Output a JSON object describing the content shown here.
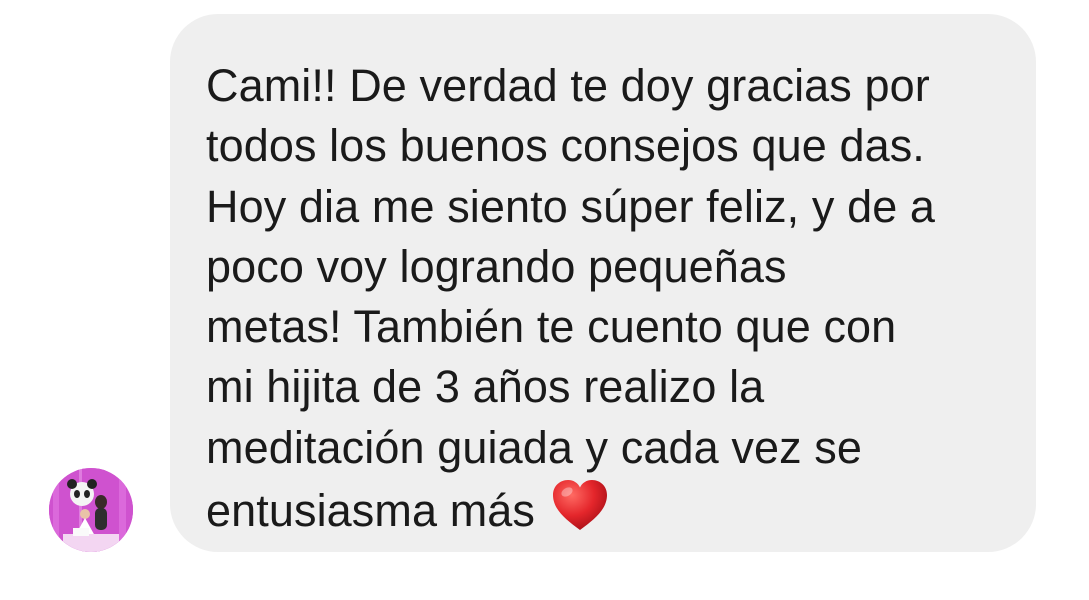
{
  "message": {
    "lines": [
      "Cami!! De verdad te doy gracias por",
      "todos los buenos consejos que das.",
      "Hoy dia me siento súper feliz, y de a",
      "poco voy logrando pequeñas",
      "metas! También te cuento que con",
      "mi hijita de 3 años realizo la",
      "meditación guiada y cada vez se",
      "entusiasma más"
    ],
    "emoji": "heart-emoji",
    "bubble_color": "#efefef",
    "text_color": "#1a1a1a"
  },
  "sender": {
    "avatar": "avatar-photo"
  }
}
